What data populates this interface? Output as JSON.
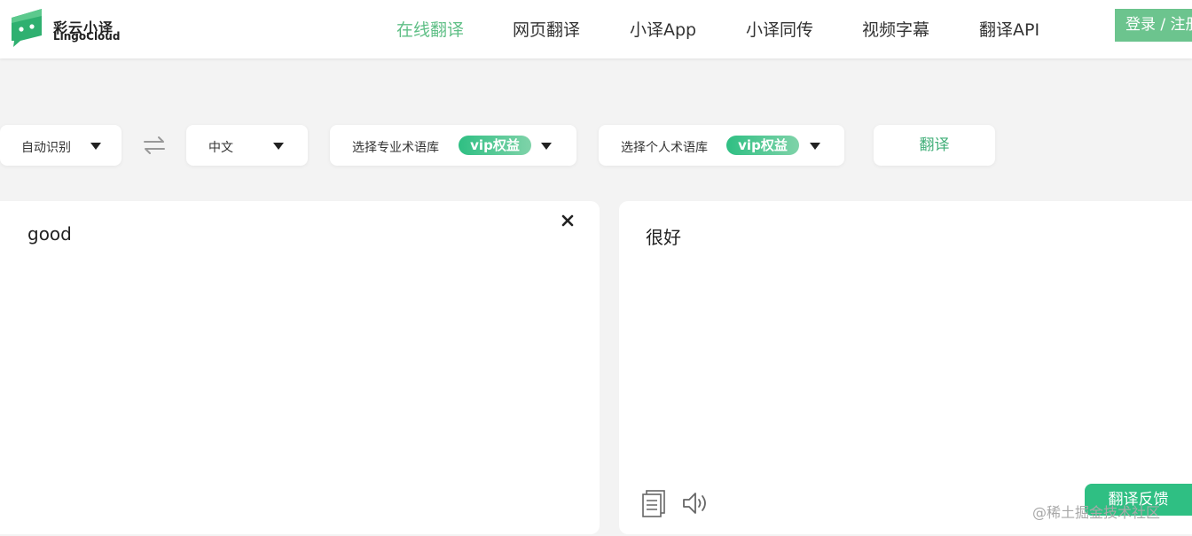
{
  "brand": {
    "name_cn": "彩云小译",
    "name_en": "LingoCloud",
    "accent": "#5fbf86",
    "logo_mark": "chat-bubble-logo"
  },
  "nav": {
    "items": [
      {
        "label": "在线翻译",
        "active": true
      },
      {
        "label": "网页翻译"
      },
      {
        "label": "小译App"
      },
      {
        "label": "小译同传"
      },
      {
        "label": "视频字幕"
      },
      {
        "label": "翻译API"
      }
    ],
    "login_label": "登录 / 注册"
  },
  "toolbar": {
    "source_lang": "自动识别",
    "swap_icon": "swap-arrows-icon",
    "target_lang": "中文",
    "pro_glossary": "选择专业术语库",
    "personal_glossary": "选择个人术语库",
    "vip_badge": "vip权益",
    "translate_label": "翻译"
  },
  "source": {
    "text": "good",
    "clear_icon": "close-icon"
  },
  "target": {
    "text": "很好",
    "copy_icon": "copy-icon",
    "speaker_icon": "speaker-icon",
    "feedback_label": "翻译反馈"
  },
  "watermark": "@稀土掘金技术社区"
}
